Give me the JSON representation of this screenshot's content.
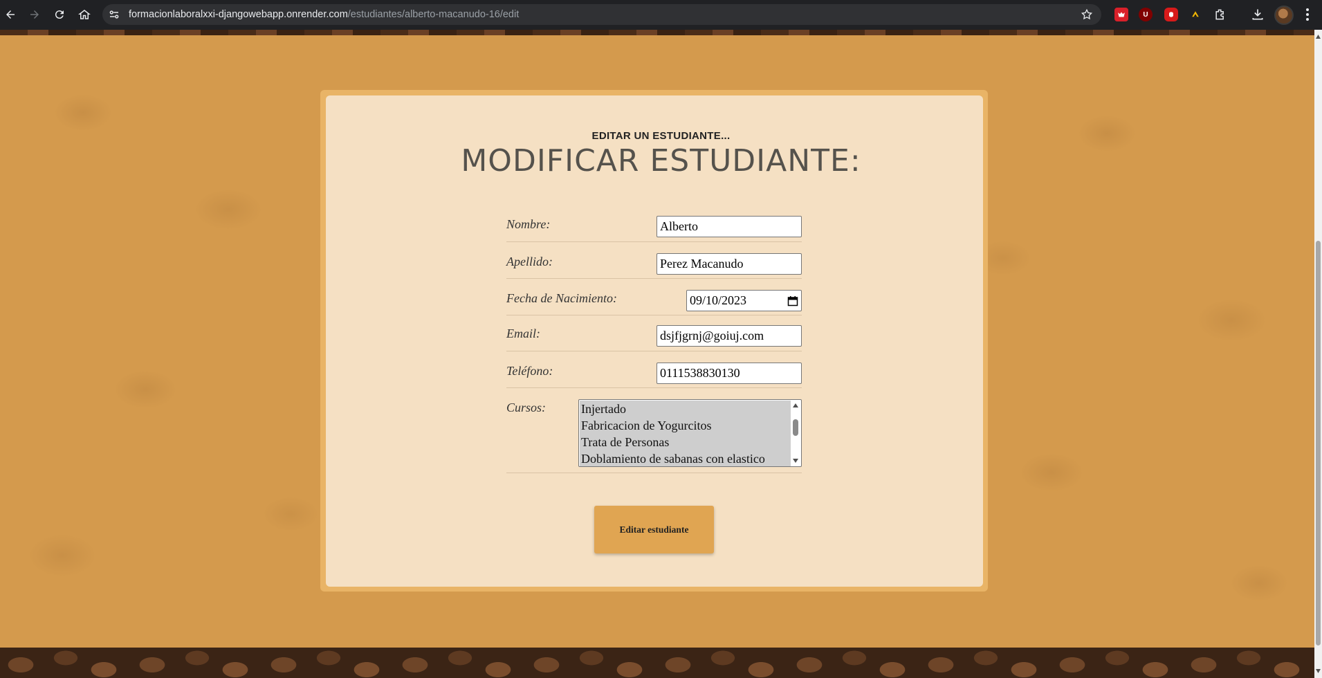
{
  "browser": {
    "url_host": "formacionlaboralxxi-djangowebapp.onrender.com",
    "url_path": "/estudiantes/alberto-macanudo-16/edit",
    "icons": [
      "back-icon",
      "forward-icon",
      "reload-icon",
      "home-icon",
      "site-info-icon",
      "star-icon",
      "extensions-icon",
      "download-icon",
      "menu-icon"
    ],
    "extension_badges": [
      "dog-icon",
      "ublock-icon",
      "hand-icon",
      "token-icon"
    ],
    "ublock_label": "U"
  },
  "form": {
    "subtitle": "EDITAR UN ESTUDIANTE...",
    "title": "MODIFICAR ESTUDIANTE:",
    "fields": {
      "nombre": {
        "label": "Nombre:",
        "value": "Alberto"
      },
      "apellido": {
        "label": "Apellido:",
        "value": "Perez Macanudo"
      },
      "fecha": {
        "label": "Fecha de Nacimiento:",
        "value": "09/10/2023"
      },
      "email": {
        "label": "Email:",
        "value": "dsjfjgrnj@goiuj.com"
      },
      "telefono": {
        "label": "Teléfono:",
        "value": "0111538830130"
      }
    },
    "cursos": {
      "label": "Cursos:",
      "options": [
        "Injertado",
        "Fabricacion de Yogurcitos",
        "Trata de Personas",
        "Doblamiento de sabanas con elastico"
      ]
    },
    "submit_label": "Editar estudiante"
  },
  "colors": {
    "page_bg": "#d49a4d",
    "card_bg": "#f5e0c3",
    "card_border": "#e9b466",
    "button_bg": "#e0a552"
  }
}
